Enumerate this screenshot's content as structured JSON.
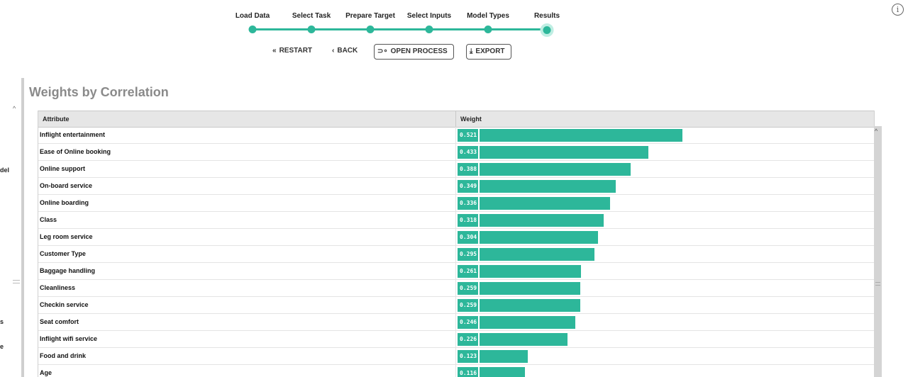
{
  "stepper": {
    "steps": [
      "Load Data",
      "Select Task",
      "Prepare Target",
      "Select Inputs",
      "Model Types",
      "Results"
    ],
    "current": "Results",
    "accent_color": "#2db79a"
  },
  "actions": {
    "restart": "RESTART",
    "back": "BACK",
    "open_process": "OPEN PROCESS",
    "export": "EXPORT"
  },
  "info_icon": "info-icon",
  "left_pane": {
    "fragments": [
      "del",
      "s",
      "e"
    ]
  },
  "title": "Weights by Correlation",
  "table": {
    "columns": [
      "Attribute",
      "Weight"
    ],
    "rows": [
      {
        "attribute": "Inflight entertainment",
        "weight": "0.521"
      },
      {
        "attribute": "Ease of Online booking",
        "weight": "0.433"
      },
      {
        "attribute": "Online support",
        "weight": "0.388"
      },
      {
        "attribute": "On-board service",
        "weight": "0.349"
      },
      {
        "attribute": "Online boarding",
        "weight": "0.336"
      },
      {
        "attribute": "Class",
        "weight": "0.318"
      },
      {
        "attribute": "Leg room service",
        "weight": "0.304"
      },
      {
        "attribute": "Customer Type",
        "weight": "0.295"
      },
      {
        "attribute": "Baggage handling",
        "weight": "0.261"
      },
      {
        "attribute": "Cleanliness",
        "weight": "0.259"
      },
      {
        "attribute": "Checkin service",
        "weight": "0.259"
      },
      {
        "attribute": "Seat comfort",
        "weight": "0.246"
      },
      {
        "attribute": "Inflight wifi service",
        "weight": "0.226"
      },
      {
        "attribute": "Food and drink",
        "weight": "0.123"
      },
      {
        "attribute": "Age",
        "weight": "0.116"
      }
    ]
  }
}
